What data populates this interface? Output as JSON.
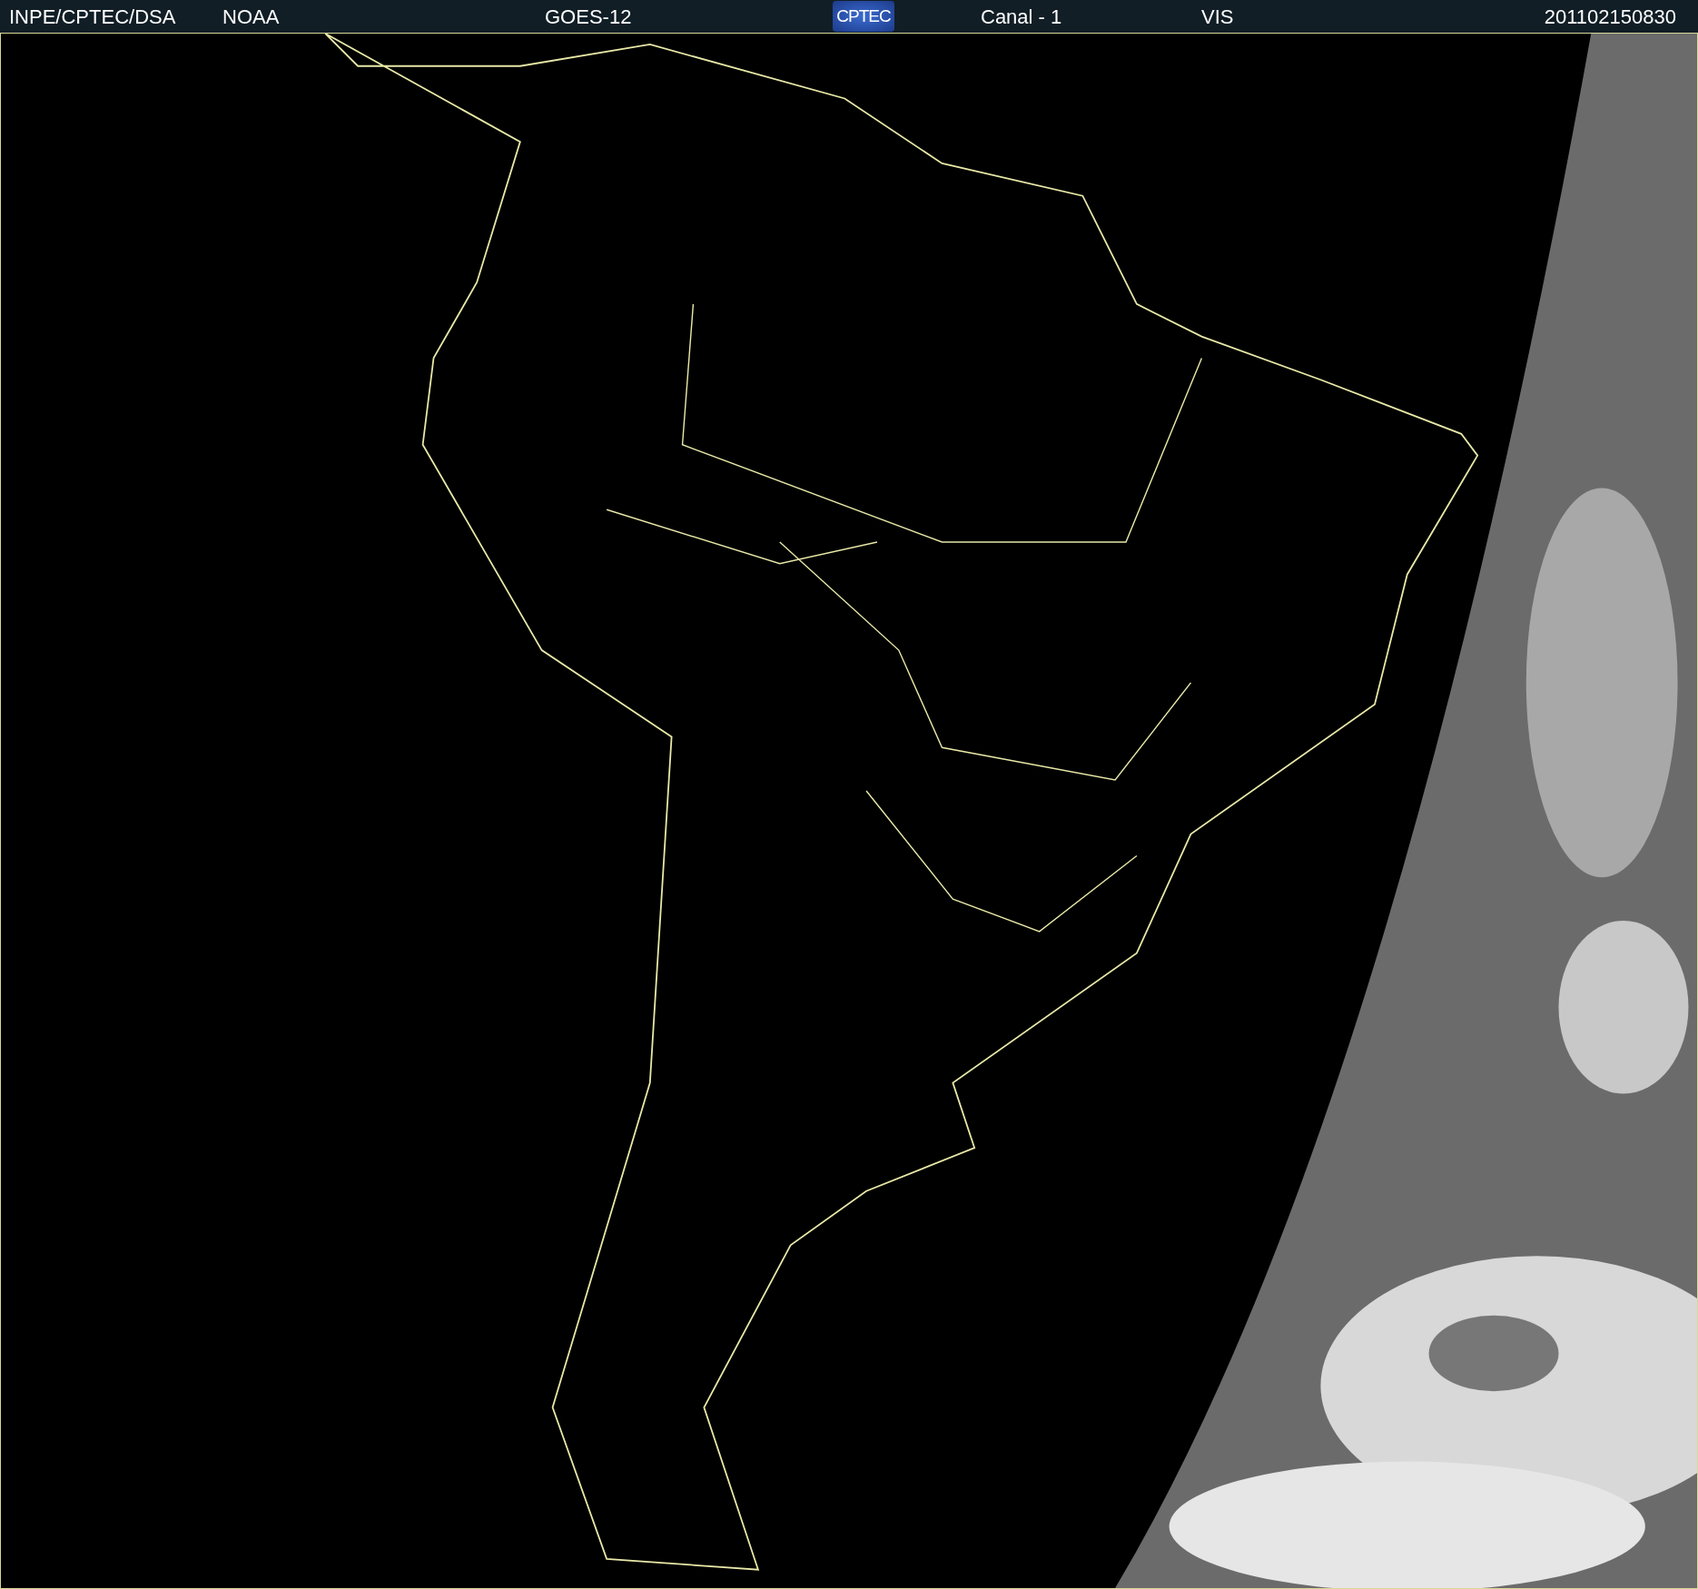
{
  "header": {
    "items": [
      "INPE/CPTEC/DSA",
      "NOAA",
      "GOES-12"
    ],
    "logo": "CPTEC",
    "channel": "Canal - 1",
    "band": "VIS",
    "timestamp": "201102150830"
  }
}
